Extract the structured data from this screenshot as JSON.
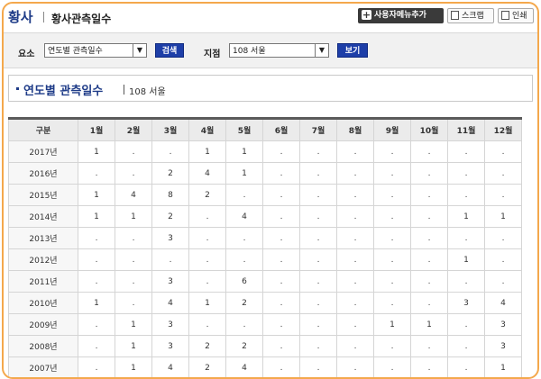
{
  "header": {
    "title": "황사",
    "subtitle": "황사관측일수",
    "menu_button": "사용자메뉴추가",
    "scrap_button": "스크랩",
    "print_button": "인쇄"
  },
  "search": {
    "element_label": "요소",
    "element_value": "연도별 관측일수",
    "search_button": "검색",
    "station_label": "지점",
    "station_value": "108 서울",
    "view_button": "보기"
  },
  "section": {
    "title": "연도별 관측일수",
    "station": "108 서울"
  },
  "table": {
    "headers": [
      "구분",
      "1월",
      "2월",
      "3월",
      "4월",
      "5월",
      "6월",
      "7월",
      "8월",
      "9월",
      "10월",
      "11월",
      "12월"
    ],
    "rows": [
      [
        "2017년",
        "1",
        ".",
        ".",
        "1",
        "1",
        ".",
        ".",
        ".",
        ".",
        ".",
        ".",
        "."
      ],
      [
        "2016년",
        ".",
        ".",
        "2",
        "4",
        "1",
        ".",
        ".",
        ".",
        ".",
        ".",
        ".",
        "."
      ],
      [
        "2015년",
        "1",
        "4",
        "8",
        "2",
        ".",
        ".",
        ".",
        ".",
        ".",
        ".",
        ".",
        "."
      ],
      [
        "2014년",
        "1",
        "1",
        "2",
        ".",
        "4",
        ".",
        ".",
        ".",
        ".",
        ".",
        "1",
        "1"
      ],
      [
        "2013년",
        ".",
        ".",
        "3",
        ".",
        ".",
        ".",
        ".",
        ".",
        ".",
        ".",
        ".",
        "."
      ],
      [
        "2012년",
        ".",
        ".",
        ".",
        ".",
        ".",
        ".",
        ".",
        ".",
        ".",
        ".",
        "1",
        "."
      ],
      [
        "2011년",
        ".",
        ".",
        "3",
        ".",
        "6",
        ".",
        ".",
        ".",
        ".",
        ".",
        ".",
        "."
      ],
      [
        "2010년",
        "1",
        ".",
        "4",
        "1",
        "2",
        ".",
        ".",
        ".",
        ".",
        ".",
        "3",
        "4"
      ],
      [
        "2009년",
        ".",
        "1",
        "3",
        ".",
        ".",
        ".",
        ".",
        ".",
        "1",
        "1",
        ".",
        "3"
      ],
      [
        "2008년",
        ".",
        "1",
        "3",
        "2",
        "2",
        ".",
        ".",
        ".",
        ".",
        ".",
        ".",
        "3"
      ],
      [
        "2007년",
        ".",
        "1",
        "4",
        "2",
        "4",
        ".",
        ".",
        ".",
        ".",
        ".",
        ".",
        "1"
      ]
    ]
  }
}
